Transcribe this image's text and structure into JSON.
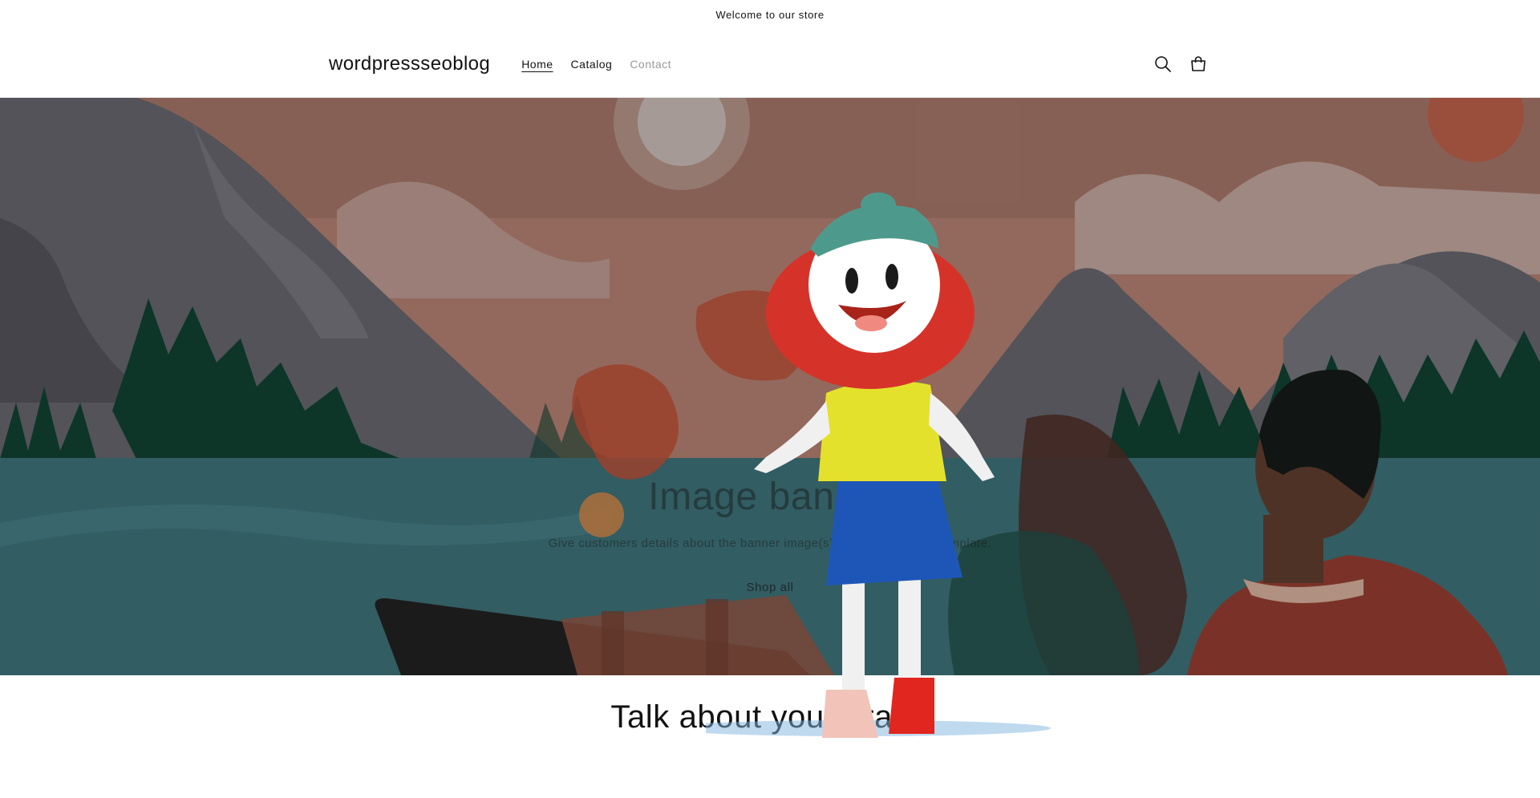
{
  "announcement": {
    "text": "Welcome to our store"
  },
  "header": {
    "logo": "wordpressseoblog",
    "nav": [
      {
        "label": "Home",
        "active": true
      },
      {
        "label": "Catalog",
        "active": false
      },
      {
        "label": "Contact",
        "active": false
      }
    ],
    "icons": [
      "search-icon",
      "cart-icon"
    ]
  },
  "banner": {
    "title": "Image banner",
    "text": "Give customers details about the banner image(s) or content on the template.",
    "button_label": "Shop all"
  },
  "brand_section": {
    "title": "Talk about your brand"
  },
  "colors": {
    "sky": "#a8786a",
    "mountain": "#5e5e66",
    "water": "#3a6a70",
    "trees": "#0f3d2e",
    "text": "#121212"
  }
}
